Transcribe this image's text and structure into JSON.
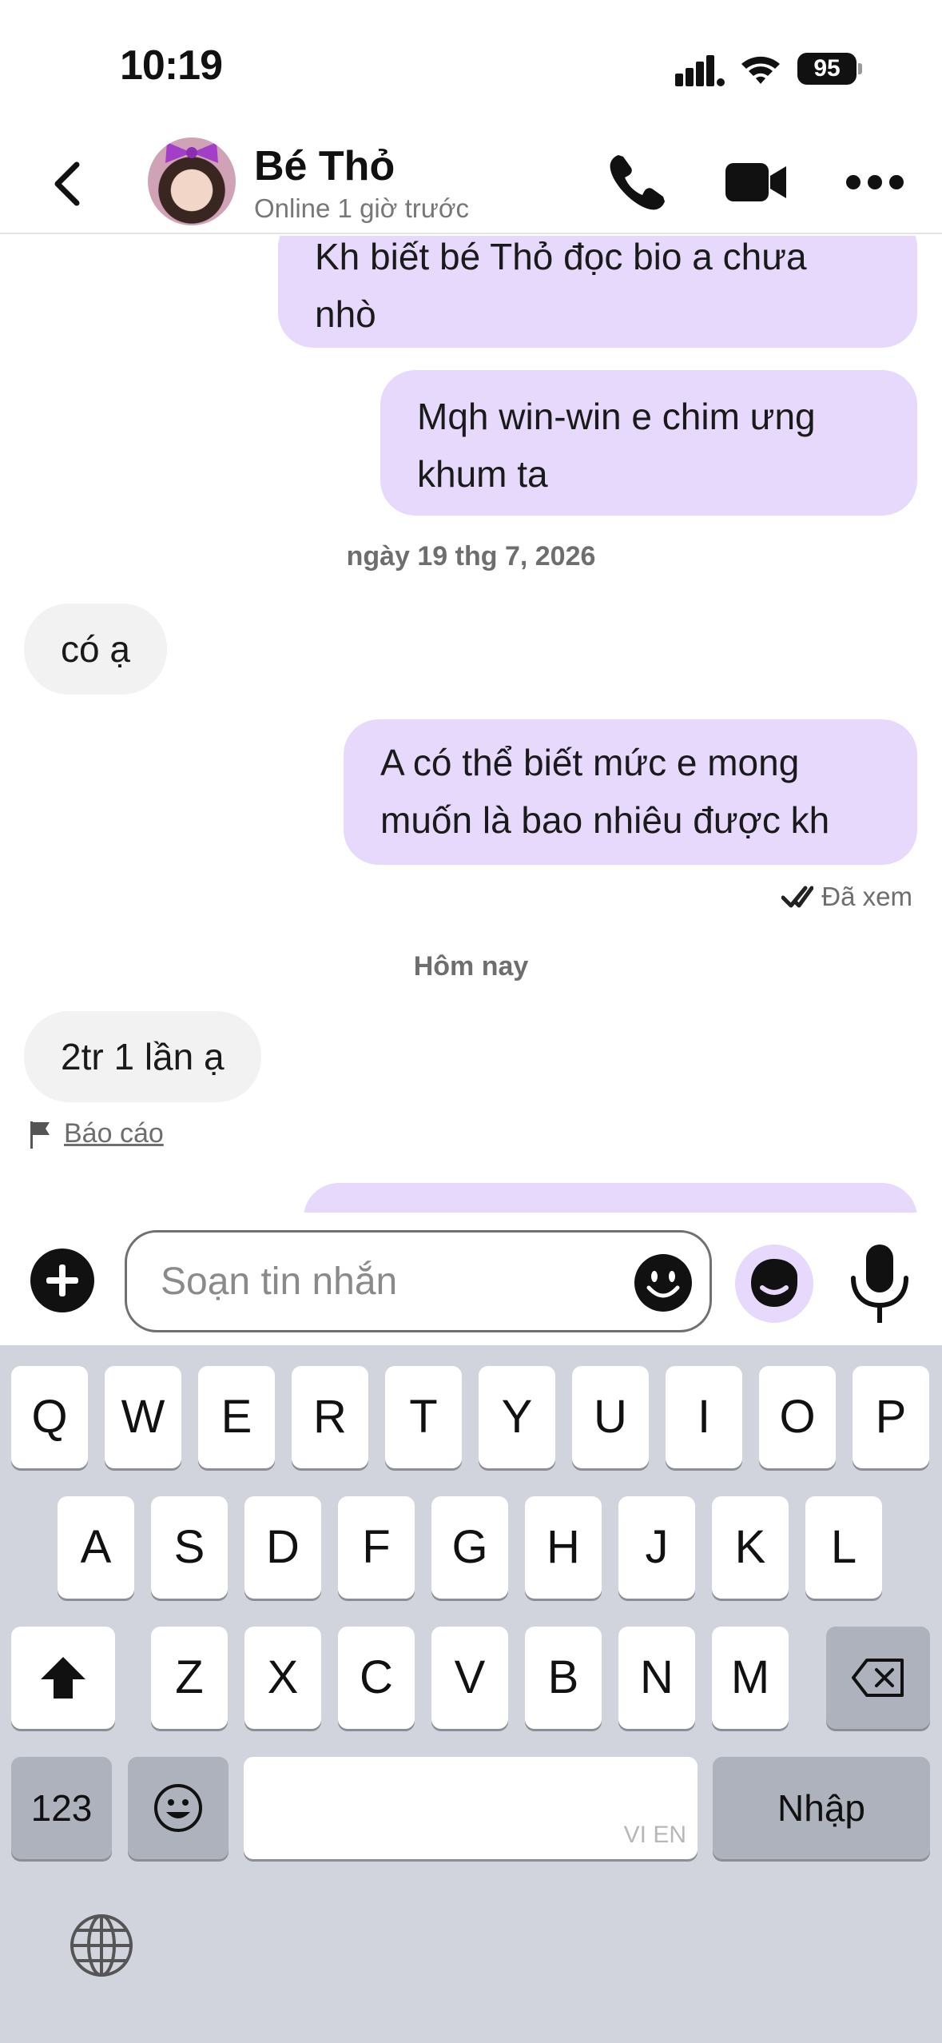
{
  "status_bar": {
    "time": "10:19",
    "battery": "95"
  },
  "header": {
    "contact_name": "Bé Thỏ",
    "contact_status": "Online 1 giờ trước"
  },
  "messages": [
    {
      "id": "m1",
      "direction": "outgoing",
      "lines": [
        "Kh biết bé Thỏ đọc bio a chưa",
        "nhò"
      ]
    },
    {
      "id": "m2",
      "direction": "outgoing",
      "lines": [
        "Mqh win-win e chim ưng",
        "khum ta"
      ]
    },
    {
      "id": "m3",
      "direction": "incoming",
      "lines": [
        "có ạ"
      ]
    },
    {
      "id": "m4",
      "direction": "outgoing",
      "lines": [
        "A có thể biết mức e mong",
        "muốn là bao nhiêu được kh"
      ]
    },
    {
      "id": "m5",
      "direction": "incoming",
      "lines": [
        "2tr 1 lần ạ"
      ]
    }
  ],
  "separators": {
    "date_1": "ngày 19 thg 7, 2026",
    "today": "Hôm nay"
  },
  "seen_label": "Đã xem",
  "report_label": "Báo cáo",
  "composer": {
    "placeholder": "Soạn tin nhắn"
  },
  "keyboard": {
    "row1": [
      "Q",
      "W",
      "E",
      "R",
      "T",
      "Y",
      "U",
      "I",
      "O",
      "P"
    ],
    "row2": [
      "A",
      "S",
      "D",
      "F",
      "G",
      "H",
      "J",
      "K",
      "L"
    ],
    "row3": [
      "Z",
      "X",
      "C",
      "V",
      "B",
      "N",
      "M"
    ],
    "numbers_key": "123",
    "space_watermark": "VI EN",
    "return_key": "Nhập"
  },
  "colors": {
    "outgoing_bubble": "#e6d9fc",
    "incoming_bubble": "#f2f2f2",
    "keyboard_bg": "#d1d4dc"
  }
}
